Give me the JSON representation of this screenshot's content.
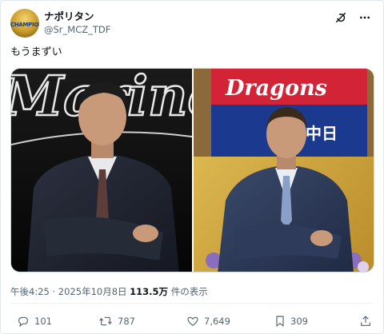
{
  "author": {
    "display_name": "ナポリタン",
    "handle": "@Sr_MCZ_TDF",
    "avatar_text": "CHAMPIONS"
  },
  "tweet": {
    "text": "もうまずい"
  },
  "media": {
    "left_photo_banner": "Marines",
    "right_photo_banner": "Dragons",
    "right_photo_flag": "中日"
  },
  "meta": {
    "time": "午後4:25",
    "separator": "·",
    "date": "2025年10月8日",
    "views_count": "113.5万",
    "views_label": "件の表示"
  },
  "actions": {
    "reply_count": "101",
    "retweet_count": "787",
    "like_count": "7,649",
    "bookmark_count": "309"
  },
  "colors": {
    "text_primary": "#0f1419",
    "text_secondary": "#536471",
    "border": "#cfd9de"
  }
}
